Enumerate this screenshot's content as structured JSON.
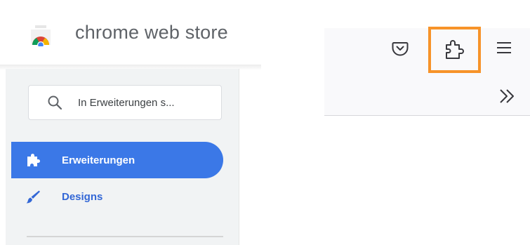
{
  "store": {
    "title": "chrome web store",
    "logo_icon": "chrome-web-store-logo",
    "search": {
      "placeholder": "In Erweiterungen s...",
      "value": "",
      "icon": "search-icon"
    },
    "nav": [
      {
        "label": "Erweiterungen",
        "icon": "puzzle-piece-icon",
        "active": true
      },
      {
        "label": "Designs",
        "icon": "paintbrush-icon",
        "active": false
      }
    ]
  },
  "toolbar": {
    "buttons": [
      {
        "name": "pocket",
        "icon": "pocket-icon"
      },
      {
        "name": "extensions",
        "icon": "puzzle-piece-outline-icon",
        "highlighted": true
      },
      {
        "name": "menu",
        "icon": "hamburger-menu-icon"
      },
      {
        "name": "overflow",
        "icon": "chevron-double-right-icon"
      }
    ],
    "highlight_color": "#f79329"
  },
  "colors": {
    "accent_blue": "#3b78e7",
    "link_blue": "#3367d6",
    "sidebar_bg": "#f1f3f4",
    "title_gray": "#5f6368"
  }
}
